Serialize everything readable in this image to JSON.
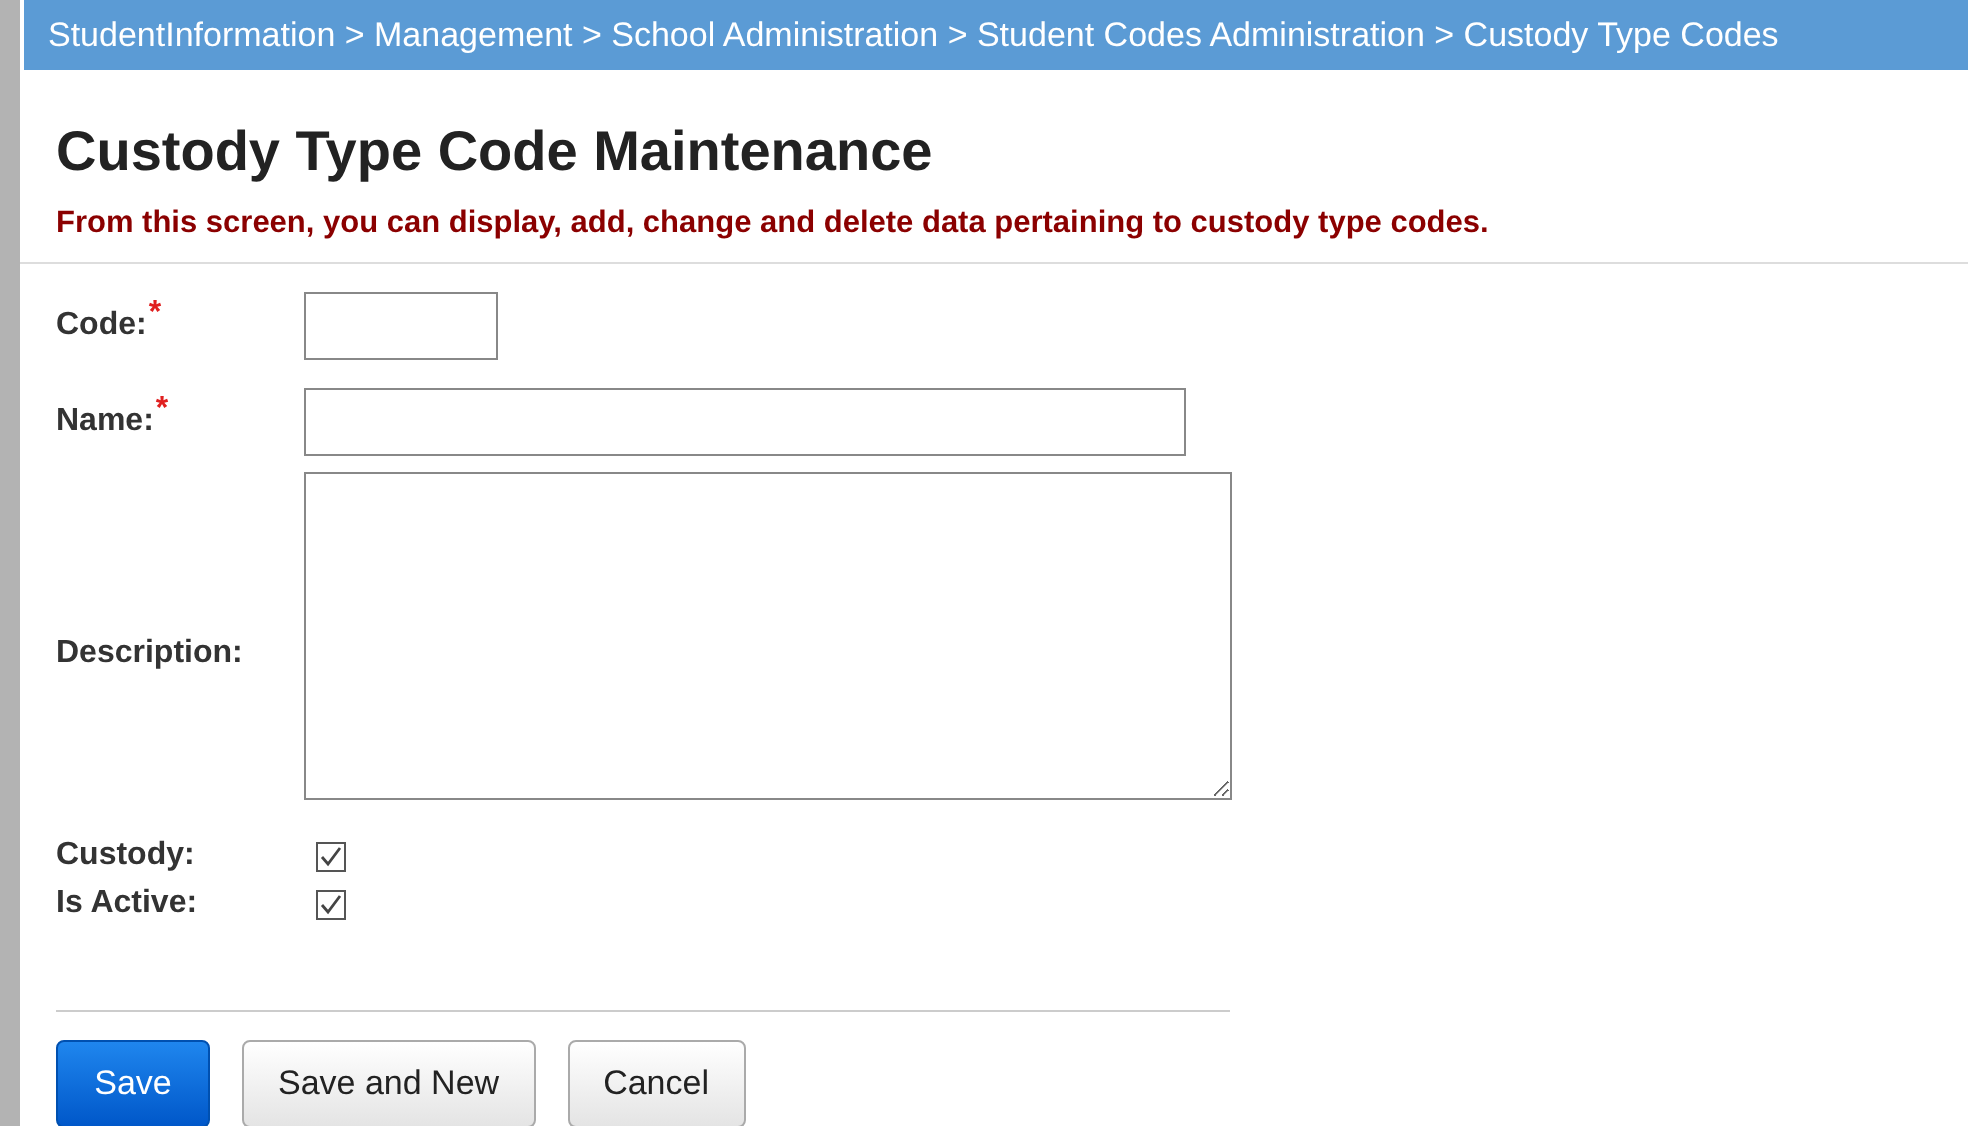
{
  "breadcrumb": "StudentInformation > Management > School Administration > Student Codes Administration > Custody Type Codes",
  "title": "Custody Type Code Maintenance",
  "instructions": "From this screen, you can display, add, change and delete data pertaining to custody type codes.",
  "fields": [
    {
      "kind": "short_text",
      "label": "Code:",
      "required_mark": "*"
    },
    {
      "kind": "text",
      "label": "Name:",
      "required_mark": "*"
    },
    {
      "kind": "textarea",
      "label": "Description:"
    },
    {
      "kind": "checkbox",
      "label": "Custody:",
      "checked": true
    },
    {
      "kind": "checkbox",
      "label": "Is Active:",
      "checked": true
    }
  ],
  "buttons": [
    {
      "label": "Save",
      "kind": "primary"
    },
    {
      "label": "Save and New",
      "kind": "default"
    },
    {
      "label": "Cancel",
      "kind": "default"
    }
  ]
}
